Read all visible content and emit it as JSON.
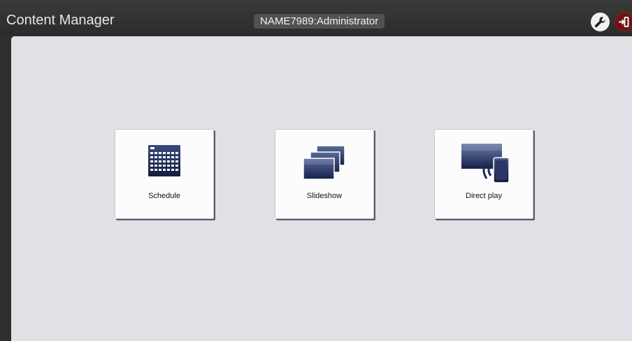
{
  "header": {
    "app_title": "Content Manager",
    "user": "NAME7989:Administrator",
    "settings_icon": "wrench-icon",
    "logout_icon": "logout-icon"
  },
  "menu": {
    "items": [
      {
        "id": "schedule",
        "label": "Schedule",
        "icon": "calendar-icon"
      },
      {
        "id": "slideshow",
        "label": "Slideshow",
        "icon": "stacked-screens-icon"
      },
      {
        "id": "direct-play",
        "label": "Direct play",
        "icon": "screen-cast-icon"
      }
    ]
  },
  "colors": {
    "topbar": "#2f2f2f",
    "content_bg": "#e1e0e6",
    "icon_navy": "#1f2b55",
    "logout_red": "#6e1212"
  }
}
